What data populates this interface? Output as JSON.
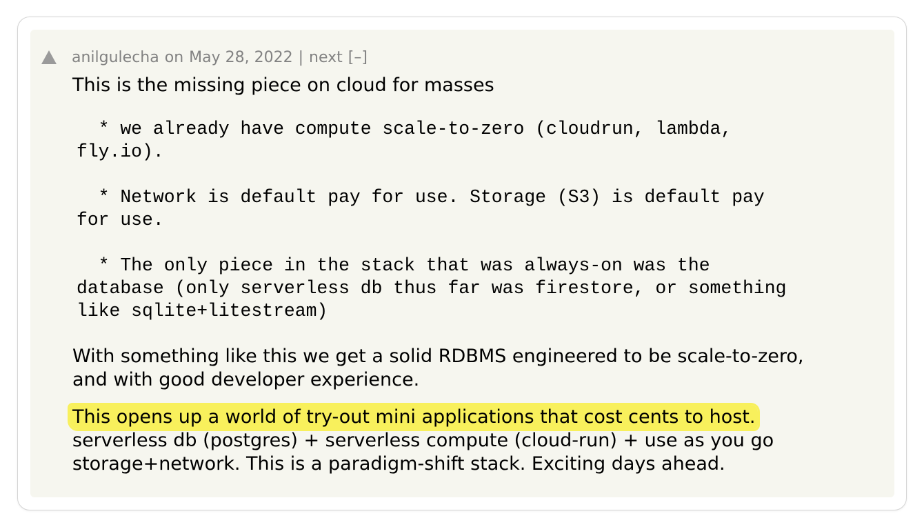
{
  "comment": {
    "author": "anilgulecha",
    "on_word": "on",
    "date": "May 28, 2022",
    "separator": "|",
    "next_label": "next",
    "collapse_label": "[–]",
    "intro": "This is the missing piece on cloud for masses",
    "bullets": [
      {
        "line1": "  * we already have compute scale-to-zero (cloudrun, lambda,",
        "line2": "fly.io)."
      },
      {
        "line1": "  * Network is default pay for use. Storage (S3) is default pay",
        "line2": "for use."
      },
      {
        "line1": "  * The only piece in the stack that was always-on was the",
        "line2": "database (only serverless db thus far was firestore, or something",
        "line3": "like sqlite+litestream)"
      }
    ],
    "para2_line1": "With something like this we get a solid RDBMS engineered to be scale-to-zero,",
    "para2_line2": "and with good developer experience.",
    "para3_highlighted": "This opens up a world of try-out mini applications that cost cents to host.",
    "para3_line2": "serverless db (postgres) + serverless compute (cloud-run) + use as you go",
    "para3_line3": "storage+network. This is a paradigm-shift stack. Exciting days ahead."
  },
  "colors": {
    "comment_background": "#f6f6ef",
    "meta_text": "#828282",
    "highlight": "#f8f05c"
  }
}
